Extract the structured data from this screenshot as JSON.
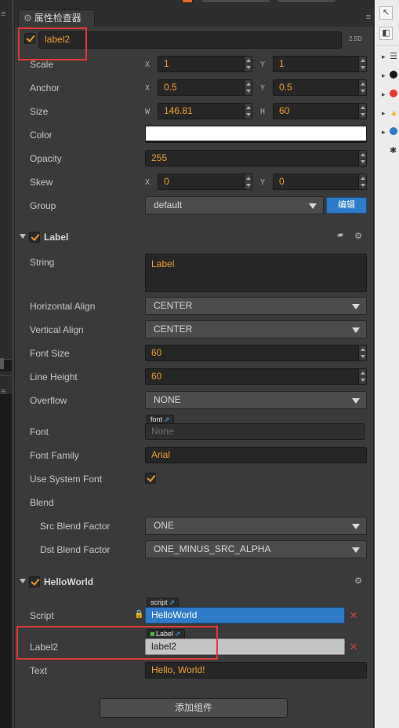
{
  "panel": {
    "tab_title": "属性检查器",
    "tab_icon": "gear-icon",
    "version_label": "2.5D"
  },
  "node": {
    "active": true,
    "name": "label2"
  },
  "node_props": {
    "scale": {
      "label": "Scale",
      "x_axis": "X",
      "x": "1",
      "y_axis": "Y",
      "y": "1"
    },
    "anchor": {
      "label": "Anchor",
      "x_axis": "X",
      "x": "0.5",
      "y_axis": "Y",
      "y": "0.5"
    },
    "size": {
      "label": "Size",
      "w_axis": "W",
      "w": "146.81",
      "h_axis": "H",
      "h": "60"
    },
    "color": {
      "label": "Color",
      "value": "#ffffff"
    },
    "opacity": {
      "label": "Opacity",
      "value": "255"
    },
    "skew": {
      "label": "Skew",
      "x_axis": "X",
      "x": "0",
      "y_axis": "Y",
      "y": "0"
    },
    "group": {
      "label": "Group",
      "value": "default",
      "edit_button": "编辑"
    }
  },
  "label_component": {
    "title": "Label",
    "enabled": true,
    "string": {
      "label": "String",
      "value": "Label"
    },
    "horizontal_align": {
      "label": "Horizontal Align",
      "value": "CENTER"
    },
    "vertical_align": {
      "label": "Vertical Align",
      "value": "CENTER"
    },
    "font_size": {
      "label": "Font Size",
      "value": "60"
    },
    "line_height": {
      "label": "Line Height",
      "value": "60"
    },
    "overflow": {
      "label": "Overflow",
      "value": "NONE"
    },
    "font": {
      "label": "Font",
      "tag": "font",
      "value": "None"
    },
    "font_family": {
      "label": "Font Family",
      "value": "Arial"
    },
    "use_system_font": {
      "label": "Use System Font",
      "checked": true
    },
    "blend": {
      "label": "Blend"
    },
    "src_blend_factor": {
      "label": "Src Blend Factor",
      "value": "ONE"
    },
    "dst_blend_factor": {
      "label": "Dst Blend Factor",
      "value": "ONE_MINUS_SRC_ALPHA"
    }
  },
  "helloworld_component": {
    "title": "HelloWorld",
    "enabled": true,
    "script": {
      "label": "Script",
      "tag": "script",
      "value": "HelloWorld"
    },
    "label2": {
      "label": "Label2",
      "tag": "Label",
      "value": "label2"
    },
    "text": {
      "label": "Text",
      "value": "Hello, World!"
    }
  },
  "add_component_button": "添加组件",
  "colors": {
    "panel_bg": "#3a3a3a",
    "field_bg": "#262626",
    "value_orange": "#f4a030",
    "accent_blue": "#2e7bc9",
    "highlight_red": "#e53935",
    "remove_red": "#d14545"
  },
  "right_rail": {
    "icons": [
      "cursor-icon",
      "collapse-panel-icon",
      "list-icon",
      "info-dark-icon",
      "error-icon",
      "warning-icon",
      "info-icon",
      "bug-icon"
    ]
  }
}
